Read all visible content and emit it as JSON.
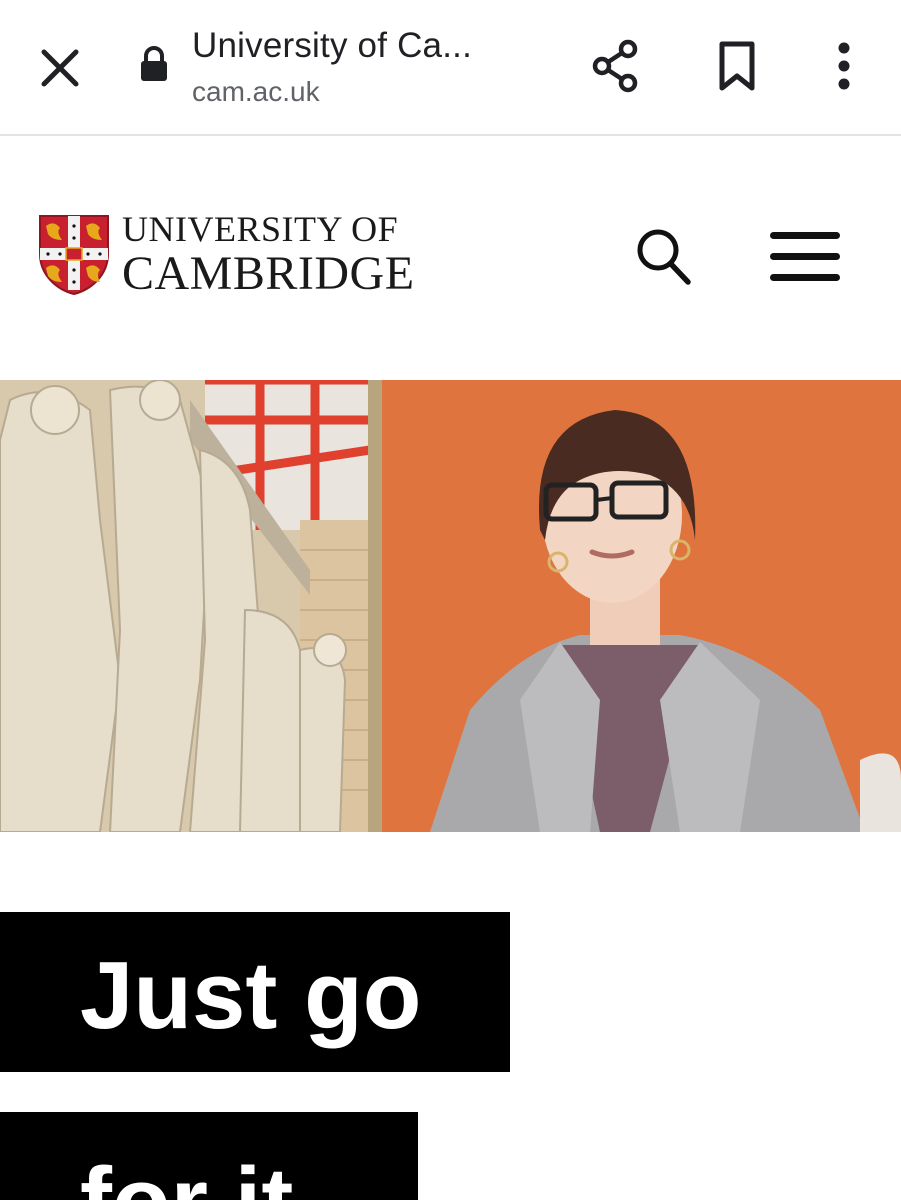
{
  "browser": {
    "tab_title": "University of Ca...",
    "url": "cam.ac.uk",
    "icons": {
      "close": "close-icon",
      "lock": "lock-icon",
      "share": "share-icon",
      "bookmark": "bookmark-icon",
      "menu": "more-vert-icon"
    }
  },
  "site": {
    "logo_line_1": "UNIVERSITY OF",
    "logo_line_2": "CAMBRIDGE",
    "icons": {
      "crest": "university-crest-logo",
      "search": "search-icon",
      "menu": "hamburger-menu-icon"
    }
  },
  "headline": {
    "line_1": "Just go",
    "line_2": "for it"
  },
  "colors": {
    "crest_red": "#c8202f",
    "crest_gold": "#e8a81c",
    "hero_orange": "#e0743f",
    "headline_bg": "#000000",
    "headline_text": "#ffffff"
  }
}
